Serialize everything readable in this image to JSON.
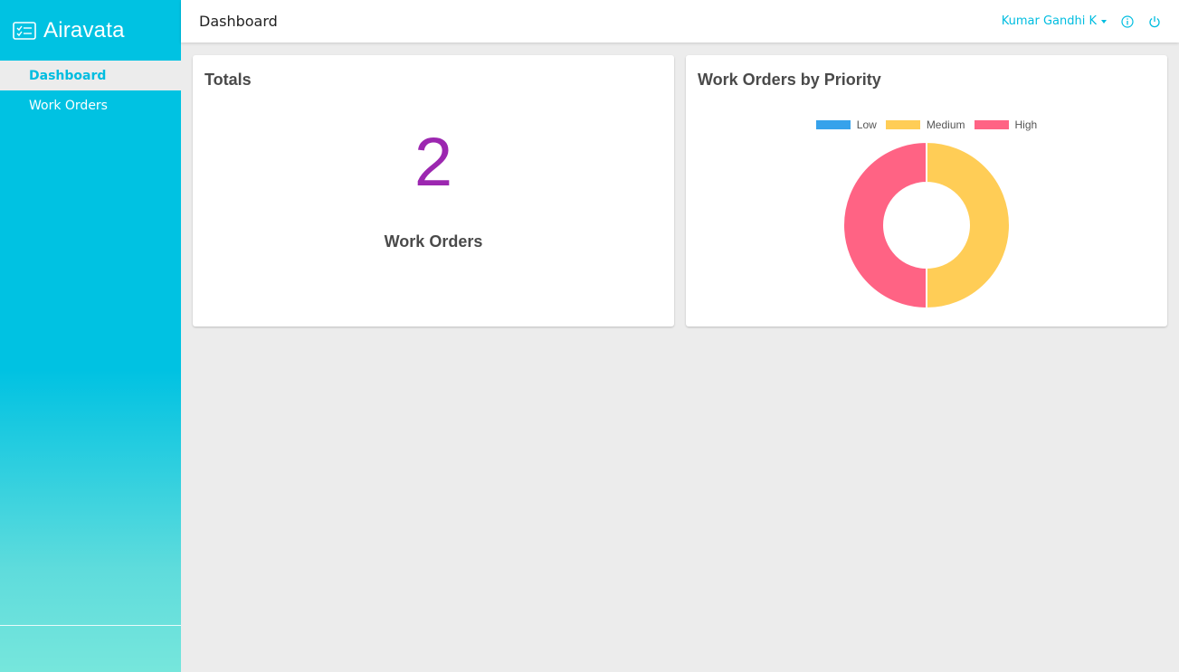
{
  "app": {
    "name": "Airavata",
    "logo_icon": "checklist-icon"
  },
  "sidebar": {
    "items": [
      {
        "label": "Dashboard",
        "active": true
      },
      {
        "label": "Work Orders",
        "active": false
      }
    ]
  },
  "header": {
    "title": "Dashboard",
    "user_name": "Kumar Gandhi K",
    "info_icon": "info-icon",
    "power_icon": "power-icon"
  },
  "totals": {
    "title": "Totals",
    "count": "2",
    "label": "Work Orders"
  },
  "priority_card": {
    "title": "Work Orders by Priority"
  },
  "colors": {
    "accent": "#00bde0",
    "total_number": "#9c27b0"
  },
  "chart_data": {
    "type": "pie",
    "title": "Work Orders by Priority",
    "categories": [
      "Low",
      "Medium",
      "High"
    ],
    "values": [
      0,
      1,
      1
    ],
    "colors": [
      "#36a2eb",
      "#ffcd56",
      "#ff6384"
    ],
    "donut": true,
    "legend": "top"
  }
}
